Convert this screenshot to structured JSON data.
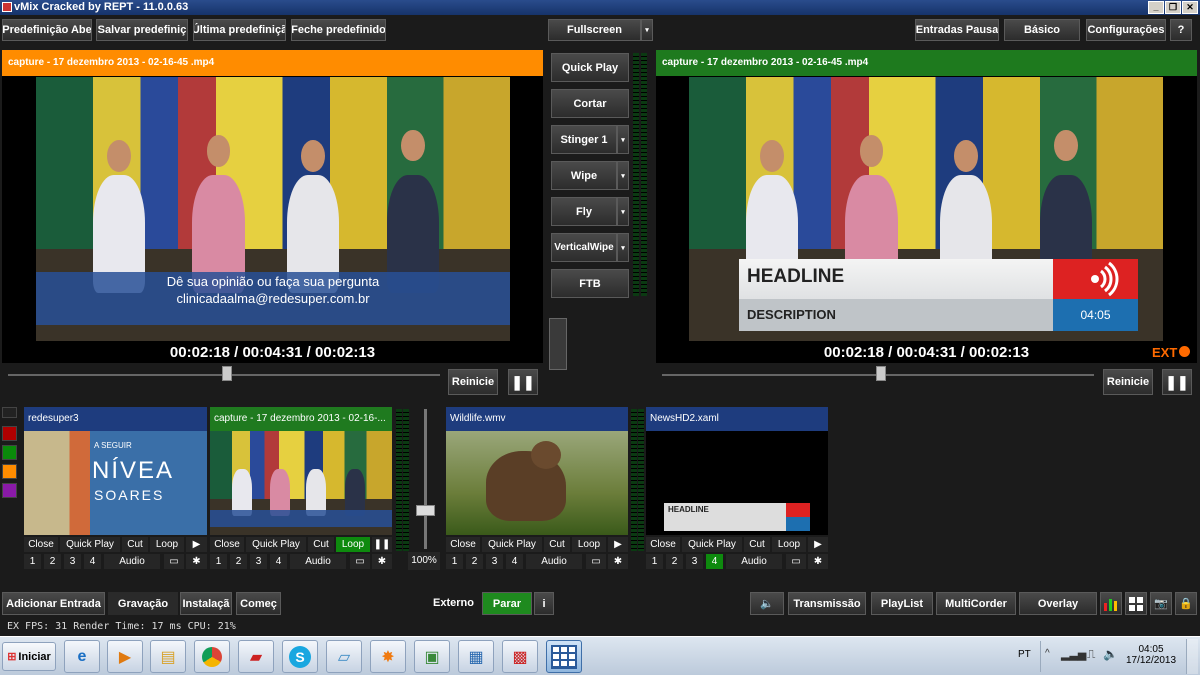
{
  "window": {
    "title": "vMix Cracked by REPT - 11.0.0.63"
  },
  "toolbar": {
    "presets": [
      "Predefinição Abe",
      "Salvar predefiniç",
      "Última predefiniçã",
      "Feche predefinido"
    ],
    "fullscreen": "Fullscreen",
    "right": [
      "Entradas Pausa",
      "Básico",
      "Configurações",
      "?"
    ]
  },
  "preview": {
    "title": "capture - 17 dezembro 2013 - 02-16-45 .mp4",
    "timecode": "00:02:18  /  00:04:31  /  00:02:13",
    "restart": "Reinicie",
    "subtitle_line1": "Dê sua opinião ou faça sua pergunta",
    "subtitle_line2": "clinicadaalma@redesuper.com.br"
  },
  "output": {
    "title": "capture - 17 dezembro 2013 - 02-16-45 .mp4",
    "timecode": "00:02:18  /  00:04:31  /  00:02:13",
    "restart": "Reinicie",
    "ext": "EXT",
    "headline": "HEADLINE",
    "description": "DESCRIPTION",
    "clock": "04:05"
  },
  "transitions": [
    "Quick Play",
    "Cortar",
    "Stinger 1",
    "Wipe",
    "Fly",
    "VerticalWipe",
    "FTB"
  ],
  "inputs": [
    {
      "title": "redesuper3",
      "color": "#1e3c7e",
      "thumb_top": "A SEGUIR",
      "thumb_main": "NÍVEA",
      "thumb_sub": "SOARES",
      "buttons": [
        "Close",
        "Quick Play",
        "Cut",
        "Loop"
      ],
      "active_num": null,
      "loop_on": false
    },
    {
      "title": "capture - 17 dezembro 2013 - 02-16-...",
      "color": "#1f7a1f",
      "buttons": [
        "Close",
        "Quick Play",
        "Cut",
        "Loop"
      ],
      "active_num": null,
      "loop_on": true
    },
    {
      "title": "Wildlife.wmv",
      "color": "#1e3c7e",
      "buttons": [
        "Close",
        "Quick Play",
        "Cut",
        "Loop"
      ],
      "active_num": null,
      "loop_on": false
    },
    {
      "title": "NewsHD2.xaml",
      "color": "#1e3c7e",
      "thumb_headline": "HEADLINE",
      "buttons": [
        "Close",
        "Quick Play",
        "Cut",
        "Loop"
      ],
      "active_num": "4",
      "loop_on": false
    }
  ],
  "numbers": [
    "1",
    "2",
    "3",
    "4"
  ],
  "audio_label": "Audio",
  "master_volume": "100%",
  "bottom": {
    "left": [
      "Adicionar Entrada",
      "Gravação",
      "Instalaçã",
      "Começ"
    ],
    "externo": "Externo",
    "parar": "Parar",
    "info": "i",
    "right": [
      "Transmissão",
      "PlayList",
      "MultiCorder",
      "Overlay"
    ]
  },
  "status": "EX FPS:  31  Render Time:  17 ms  CPU:  21%",
  "taskbar": {
    "start": "Iniciar",
    "lang": "PT",
    "time": "04:05",
    "date": "17/12/2013"
  },
  "colors": {
    "preview_accent": "#ff8c00",
    "output_accent": "#1e7a1e",
    "input_blue": "#1e3c7e",
    "ext": "#ff6a00"
  }
}
